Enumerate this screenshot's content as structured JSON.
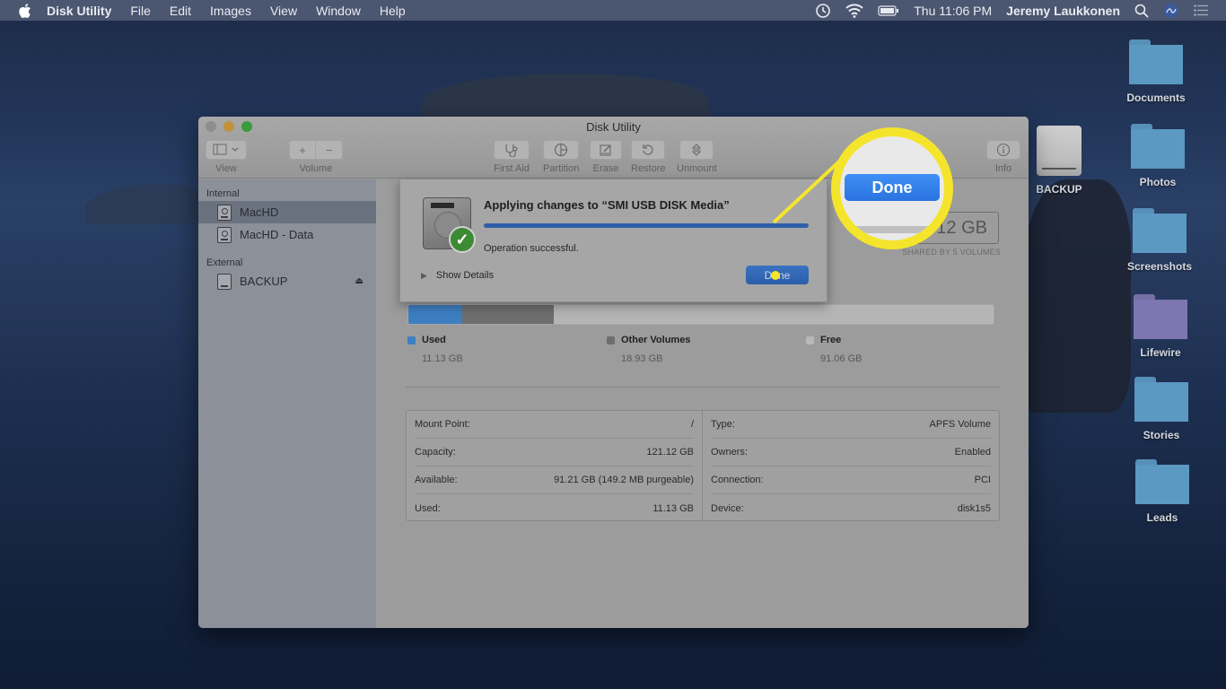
{
  "menubar": {
    "apple_icon": "apple-logo-icon",
    "app_name": "Disk Utility",
    "menus": [
      "File",
      "Edit",
      "Images",
      "View",
      "Window",
      "Help"
    ],
    "status_icons": [
      "time-machine-icon",
      "wifi-icon",
      "battery-icon"
    ],
    "clock": "Thu 11:06 PM",
    "user": "Jeremy Laukkonen",
    "right_icons": [
      "spotlight-search-icon",
      "siri-icon",
      "notification-center-icon"
    ]
  },
  "window": {
    "title": "Disk Utility",
    "toolbar": {
      "view_label": "View",
      "volume_label": "Volume",
      "volume_add": "+",
      "volume_remove": "−",
      "first_aid_label": "First Aid",
      "partition_label": "Partition",
      "erase_label": "Erase",
      "restore_label": "Restore",
      "unmount_label": "Unmount",
      "info_label": "Info"
    },
    "sidebar": {
      "sections": [
        {
          "header": "Internal",
          "items": [
            {
              "label": "MacHD",
              "selected": true
            },
            {
              "label": "MacHD - Data",
              "selected": false
            }
          ]
        },
        {
          "header": "External",
          "items": [
            {
              "label": "BACKUP",
              "selected": false,
              "ejectable": true
            }
          ]
        }
      ]
    },
    "main": {
      "capacity_partial": "12 GB",
      "capacity_sub": "SHARED BY 5 VOLUMES",
      "usage": [
        {
          "name": "Used",
          "value": "11.13 GB",
          "gb": 11.13,
          "color": "#3d7fc2"
        },
        {
          "name": "Other Volumes",
          "value": "18.93 GB",
          "gb": 18.93,
          "color": "#6e6e6e"
        },
        {
          "name": "Free",
          "value": "91.06 GB",
          "gb": 91.06,
          "color": "#b5b5b5"
        }
      ],
      "info_left": [
        {
          "label": "Mount Point:",
          "value": "/"
        },
        {
          "label": "Capacity:",
          "value": "121.12 GB"
        },
        {
          "label": "Available:",
          "value": "91.21 GB (149.2 MB purgeable)"
        },
        {
          "label": "Used:",
          "value": "11.13 GB"
        }
      ],
      "info_right": [
        {
          "label": "Type:",
          "value": "APFS Volume"
        },
        {
          "label": "Owners:",
          "value": "Enabled"
        },
        {
          "label": "Connection:",
          "value": "PCI"
        },
        {
          "label": "Device:",
          "value": "disk1s5"
        }
      ]
    }
  },
  "sheet": {
    "title": "Applying changes to “SMI USB DISK Media”",
    "progress_percent": 100,
    "status": "Operation successful.",
    "show_details": "Show Details",
    "done_label": "Done",
    "callout_done_label": "Done",
    "accent": "#f4e52c"
  },
  "desktop": {
    "drive": {
      "label": "BACKUP"
    },
    "folders": [
      {
        "label": "Documents",
        "color": "#5b98c2"
      },
      {
        "label": "Photos",
        "color": "#5b98c2"
      },
      {
        "label": "Screenshots",
        "color": "#5b98c2"
      },
      {
        "label": "Lifewire",
        "color": "#7d76b0"
      },
      {
        "label": "Stories",
        "color": "#5b98c2"
      },
      {
        "label": "Leads",
        "color": "#5b98c2"
      }
    ]
  }
}
